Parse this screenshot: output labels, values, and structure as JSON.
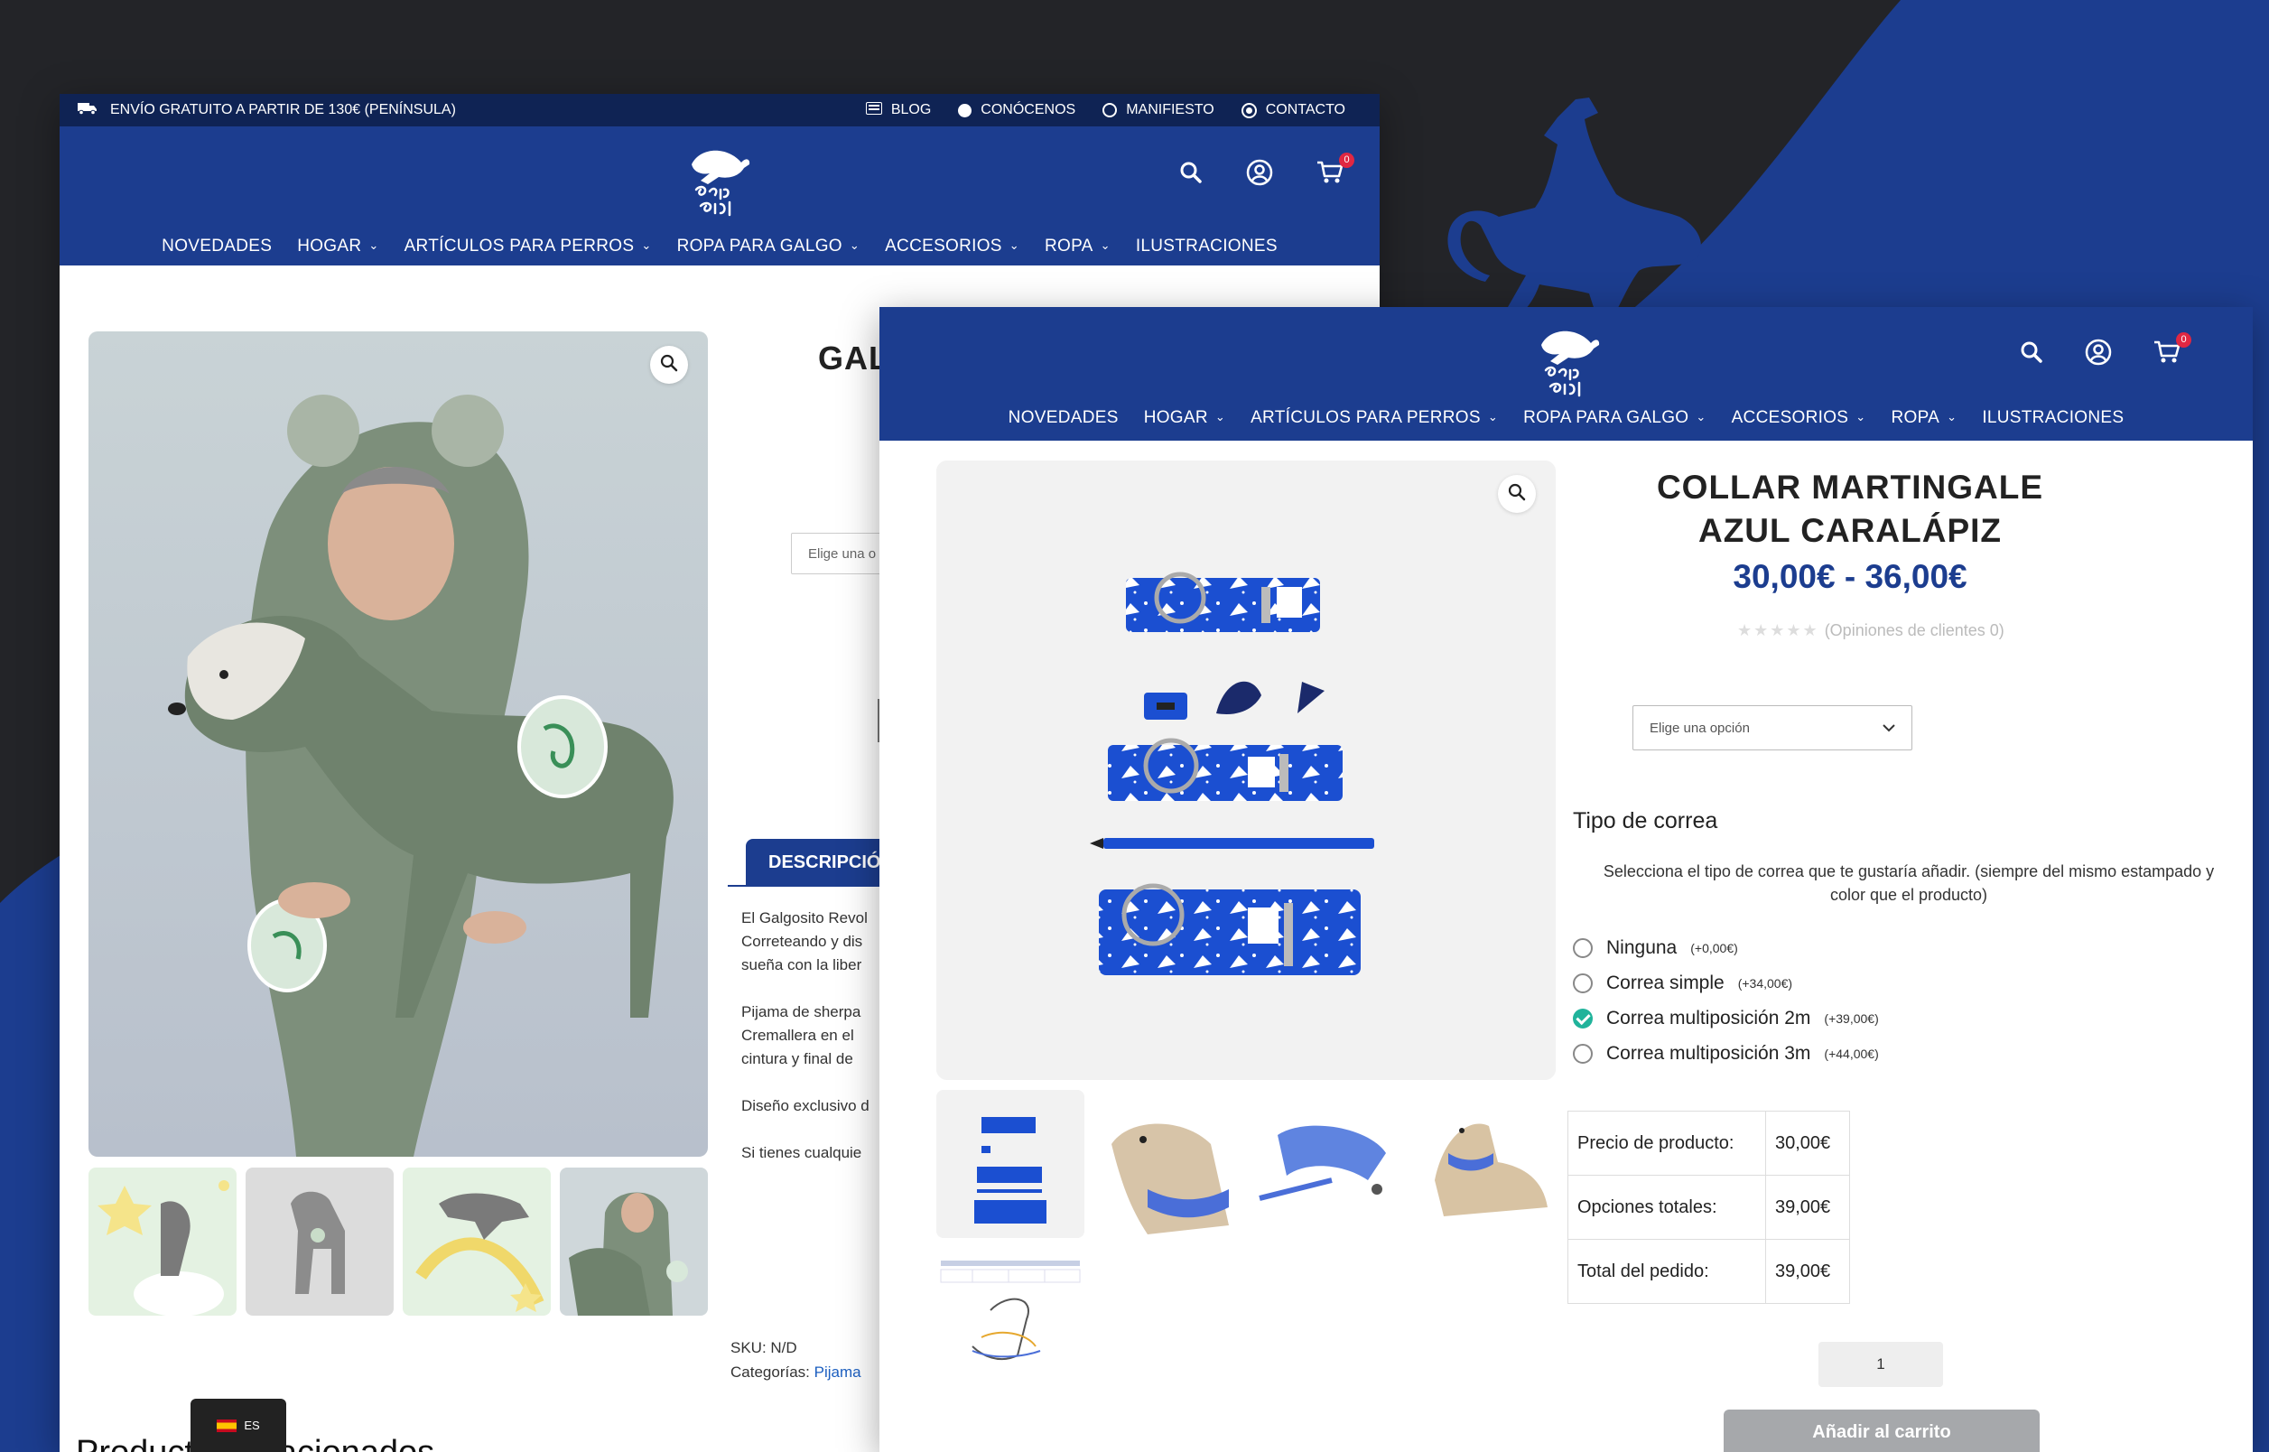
{
  "colors": {
    "brand_blue": "#1c3d8f",
    "topbar_navy": "#0f2354",
    "price_blue": "#1c3d8f",
    "badge_red": "#e02742",
    "check_teal": "#20b39b",
    "background_dark": "#232428"
  },
  "back_window": {
    "topbar": {
      "shipping_icon": "truck-icon",
      "shipping_text": "ENVÍO GRATUITO A PARTIR DE 130€ (PENÍNSULA)",
      "links": [
        {
          "icon": "blog-icon",
          "label": "BLOG"
        },
        {
          "icon": "circle-icon",
          "label": "CONÓCENOS"
        },
        {
          "icon": "circle-outline-icon",
          "label": "MANIFIESTO"
        },
        {
          "icon": "target-icon",
          "label": "CONTACTO"
        }
      ]
    },
    "header": {
      "cart_count": "0",
      "nav": [
        {
          "label": "NOVEDADES",
          "dropdown": false
        },
        {
          "label": "HOGAR",
          "dropdown": true
        },
        {
          "label": "ARTÍCULOS PARA PERROS",
          "dropdown": true
        },
        {
          "label": "ROPA PARA GALGO",
          "dropdown": true
        },
        {
          "label": "ACCESORIOS",
          "dropdown": true
        },
        {
          "label": "ROPA",
          "dropdown": true
        },
        {
          "label": "ILUSTRACIONES",
          "dropdown": false
        }
      ]
    },
    "product": {
      "title": "GAL",
      "select_placeholder": "Elige una o",
      "tab_label": "DESCRIPCIÓN",
      "description": [
        "El Galgosito Revol",
        "Correteando y dis",
        "sueña con la liber",
        "Pijama de sherpa",
        "Cremallera en el",
        "cintura y final de",
        "Diseño exclusivo d",
        "Si tienes cualquie"
      ],
      "sku": "SKU: N/D",
      "categories_label": "Categorías:",
      "categories_value": "Pijama",
      "bottom_heading": "Productos relacionados"
    },
    "language": "ES"
  },
  "front_window": {
    "header": {
      "cart_count": "0",
      "nav": [
        {
          "label": "NOVEDADES",
          "dropdown": false
        },
        {
          "label": "HOGAR",
          "dropdown": true
        },
        {
          "label": "ARTÍCULOS PARA PERROS",
          "dropdown": true
        },
        {
          "label": "ROPA PARA GALGO",
          "dropdown": true
        },
        {
          "label": "ACCESORIOS",
          "dropdown": true
        },
        {
          "label": "ROPA",
          "dropdown": true
        },
        {
          "label": "ILUSTRACIONES",
          "dropdown": false
        }
      ]
    },
    "product": {
      "title": "COLLAR MARTINGALE AZUL CARALÁPIZ",
      "price": "30,00€ - 36,00€",
      "rating_stars": 0,
      "reviews": "(Opiniones de clientes 0)",
      "select_placeholder": "Elige una opción",
      "options_title": "Tipo de correa",
      "options_desc": "Selecciona el tipo de correa que te gustaría añadir. (siempre del mismo estampado y color que el producto)",
      "options": [
        {
          "label": "Ninguna",
          "price": "(+0,00€)",
          "selected": false
        },
        {
          "label": "Correa simple",
          "price": "(+34,00€)",
          "selected": false
        },
        {
          "label": "Correa multiposición 2m",
          "price": "(+39,00€)",
          "selected": true
        },
        {
          "label": "Correa multiposición 3m",
          "price": "(+44,00€)",
          "selected": false
        }
      ],
      "totals": [
        {
          "label": "Precio de producto:",
          "value": "30,00€"
        },
        {
          "label": "Opciones totales:",
          "value": "39,00€"
        },
        {
          "label": "Total del pedido:",
          "value": "39,00€"
        }
      ],
      "quantity": "1",
      "add_to_cart": "Añadir al carrito"
    }
  }
}
